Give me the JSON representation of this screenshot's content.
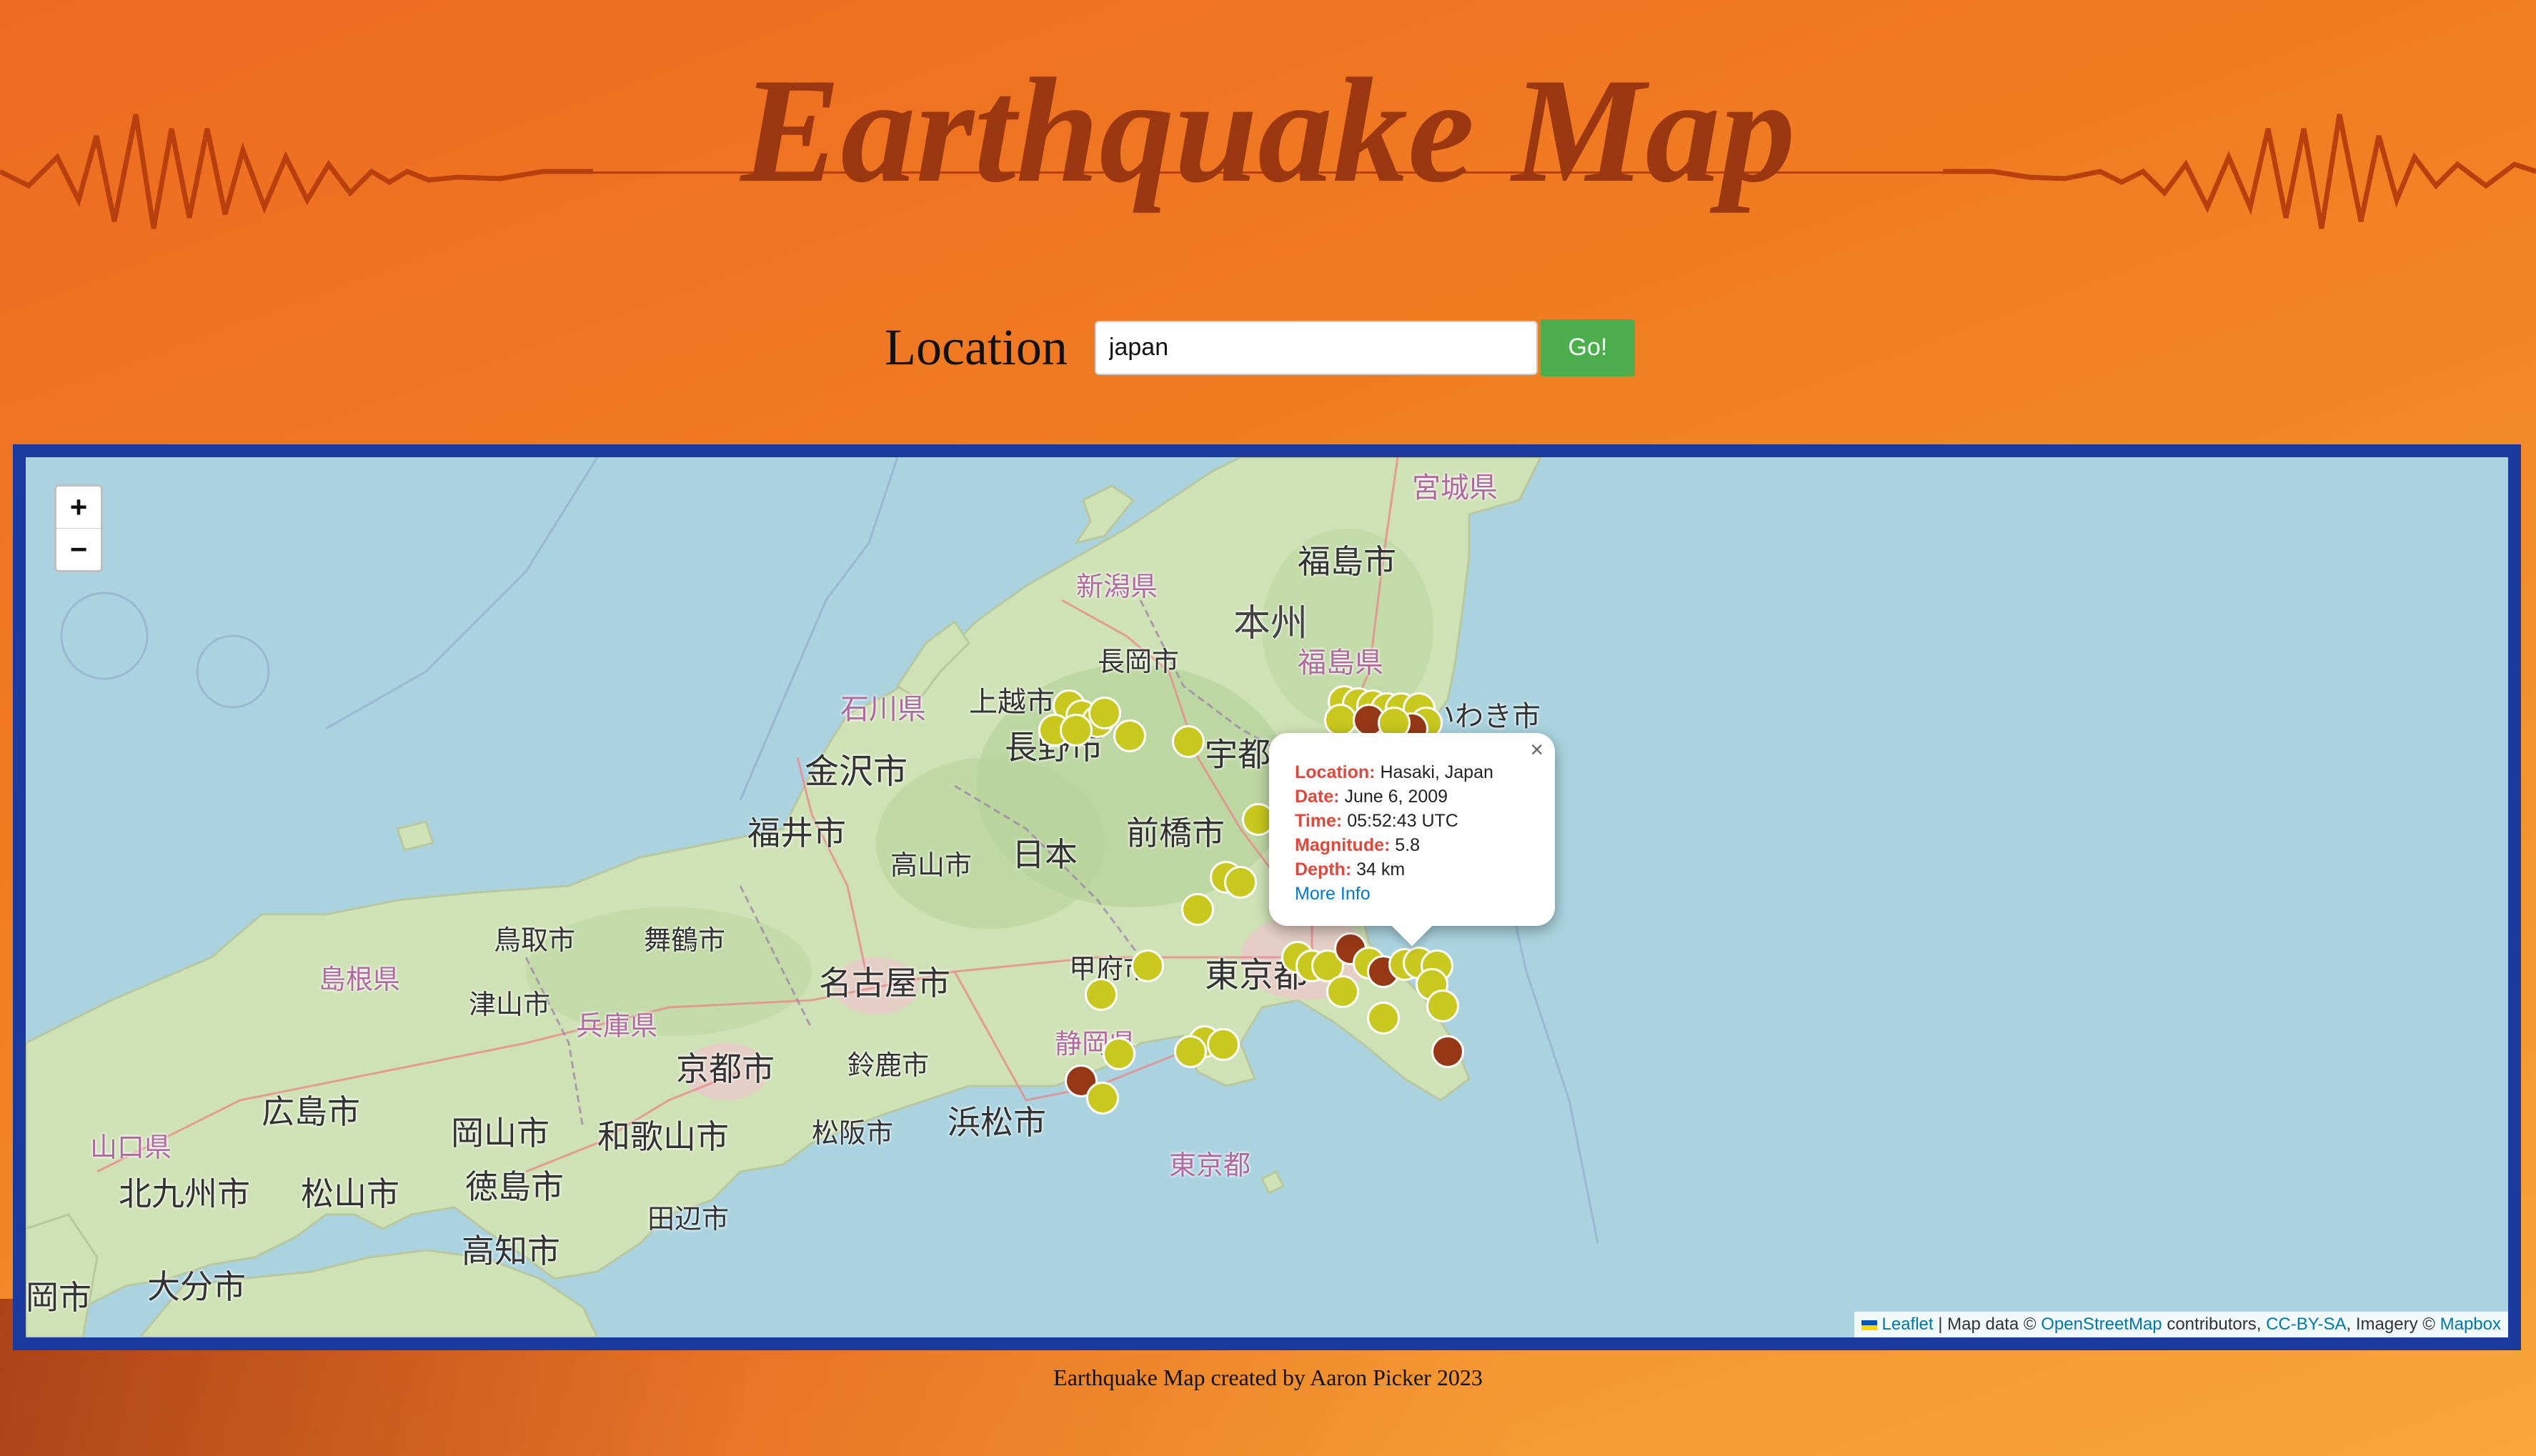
{
  "header": {
    "title": "Earthquake Map"
  },
  "search": {
    "label": "Location",
    "value": "japan",
    "button": "Go!"
  },
  "map": {
    "zoom_in": "+",
    "zoom_out": "−",
    "labels": [
      {
        "text": "宮城県",
        "kind": "pref"
      },
      {
        "text": "新潟県",
        "kind": "pref"
      },
      {
        "text": "福島市",
        "kind": "city"
      },
      {
        "text": "本州",
        "kind": "big"
      },
      {
        "text": "福島県",
        "kind": "pref"
      },
      {
        "text": "長岡市",
        "kind": "city"
      },
      {
        "text": "石川県",
        "kind": "pref"
      },
      {
        "text": "上越市",
        "kind": "city"
      },
      {
        "text": "いわき市",
        "kind": "city"
      },
      {
        "text": "金沢市",
        "kind": "city"
      },
      {
        "text": "長野市",
        "kind": "city"
      },
      {
        "text": "宇都宮",
        "kind": "city"
      },
      {
        "text": "福井市",
        "kind": "city"
      },
      {
        "text": "前橋市",
        "kind": "city"
      },
      {
        "text": "高山市",
        "kind": "city"
      },
      {
        "text": "日本",
        "kind": "city"
      },
      {
        "text": "鳥取市",
        "kind": "city"
      },
      {
        "text": "舞鶴市",
        "kind": "city"
      },
      {
        "text": "島根県",
        "kind": "pref"
      },
      {
        "text": "名古屋市",
        "kind": "city"
      },
      {
        "text": "甲府市",
        "kind": "city"
      },
      {
        "text": "東京都",
        "kind": "city"
      },
      {
        "text": "津山市",
        "kind": "city"
      },
      {
        "text": "兵庫県",
        "kind": "pref"
      },
      {
        "text": "静岡県",
        "kind": "pref"
      },
      {
        "text": "京都市",
        "kind": "city"
      },
      {
        "text": "鈴鹿市",
        "kind": "city"
      },
      {
        "text": "広島市",
        "kind": "city"
      },
      {
        "text": "岡山市",
        "kind": "city"
      },
      {
        "text": "浜松市",
        "kind": "city"
      },
      {
        "text": "山口県",
        "kind": "pref"
      },
      {
        "text": "和歌山市",
        "kind": "city"
      },
      {
        "text": "松阪市",
        "kind": "city"
      },
      {
        "text": "東京都",
        "kind": "pref"
      },
      {
        "text": "北九州市",
        "kind": "city"
      },
      {
        "text": "松山市",
        "kind": "city"
      },
      {
        "text": "徳島市",
        "kind": "city"
      },
      {
        "text": "田辺市",
        "kind": "city"
      },
      {
        "text": "高知市",
        "kind": "city"
      },
      {
        "text": "大分市",
        "kind": "city"
      },
      {
        "text": "岡市",
        "kind": "city"
      }
    ],
    "popup": {
      "close": "×",
      "location_label": "Location:",
      "location": "Hasaki, Japan",
      "date_label": "Date:",
      "date": "June 6, 2009",
      "time_label": "Time:",
      "time": "05:52:43 UTC",
      "magnitude_label": "Magnitude:",
      "magnitude": "5.8",
      "depth_label": "Depth:",
      "depth": "34 km",
      "more_info": "More Info"
    },
    "attribution": {
      "leaflet": "Leaflet",
      "sep1": " | Map data © ",
      "osm": "OpenStreetMap",
      "contrib": " contributors, ",
      "license": "CC-BY-SA",
      "imagery": ", Imagery © ",
      "mapbox": "Mapbox"
    },
    "colors": {
      "minor": "#c8c81e",
      "major": "#963816"
    }
  },
  "footer": {
    "text": "Earthquake Map created by Aaron Picker 2023"
  }
}
